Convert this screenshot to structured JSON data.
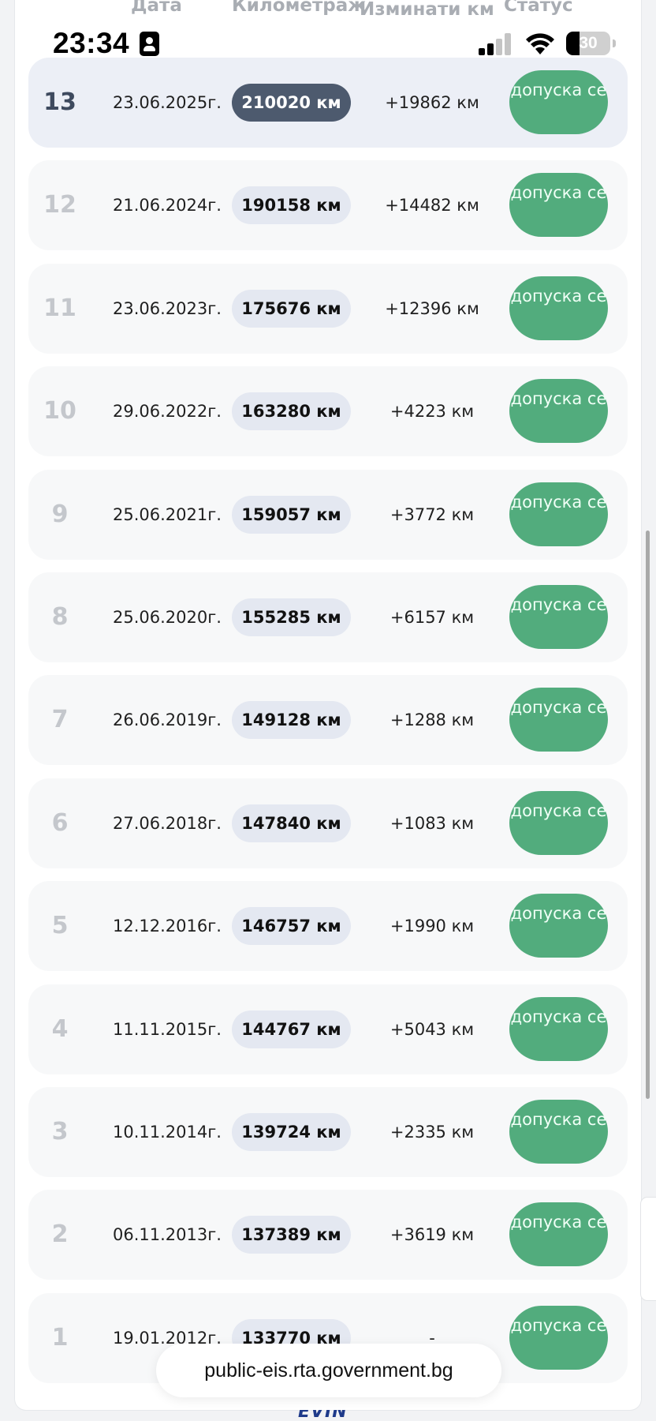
{
  "status_bar": {
    "time": "23:34",
    "battery_level": "30"
  },
  "table": {
    "headers": {
      "date": "Дата",
      "mileage": "Километраж",
      "changed": "Изминати км",
      "status": "Статус"
    },
    "rows": [
      {
        "num": "13",
        "date": "23.06.2025г.",
        "km": "210020 км",
        "delta": "+19862 км",
        "status": "допуска се"
      },
      {
        "num": "12",
        "date": "21.06.2024г.",
        "km": "190158 км",
        "delta": "+14482 км",
        "status": "допуска се"
      },
      {
        "num": "11",
        "date": "23.06.2023г.",
        "km": "175676 км",
        "delta": "+12396 км",
        "status": "допуска се"
      },
      {
        "num": "10",
        "date": "29.06.2022г.",
        "km": "163280 км",
        "delta": "+4223 км",
        "status": "допуска се"
      },
      {
        "num": "9",
        "date": "25.06.2021г.",
        "km": "159057 км",
        "delta": "+3772 км",
        "status": "допуска се"
      },
      {
        "num": "8",
        "date": "25.06.2020г.",
        "km": "155285 км",
        "delta": "+6157 км",
        "status": "допуска се"
      },
      {
        "num": "7",
        "date": "26.06.2019г.",
        "km": "149128 км",
        "delta": "+1288 км",
        "status": "допуска се"
      },
      {
        "num": "6",
        "date": "27.06.2018г.",
        "km": "147840 км",
        "delta": "+1083 км",
        "status": "допуска се"
      },
      {
        "num": "5",
        "date": "12.12.2016г.",
        "km": "146757 км",
        "delta": "+1990 км",
        "status": "допуска се"
      },
      {
        "num": "4",
        "date": "11.11.2015г.",
        "km": "144767 км",
        "delta": "+5043 км",
        "status": "допуска се"
      },
      {
        "num": "3",
        "date": "10.11.2014г.",
        "km": "139724 км",
        "delta": "+2335 км",
        "status": "допуска се"
      },
      {
        "num": "2",
        "date": "06.11.2013г.",
        "km": "137389 км",
        "delta": "+3619 км",
        "status": "допуска се"
      },
      {
        "num": "1",
        "date": "19.01.2012г.",
        "km": "133770 км",
        "delta": "-",
        "status": "допуска се"
      }
    ]
  },
  "browser": {
    "url": "public-eis.rta.government.bg"
  },
  "footer": {
    "logo_text": "EVIN"
  },
  "colors": {
    "status_green": "#52ac7d",
    "active_km_pill": "#4d5a6e",
    "km_pill": "#e4e8f1",
    "active_row": "#eceff6",
    "row": "#f7f8f9"
  }
}
